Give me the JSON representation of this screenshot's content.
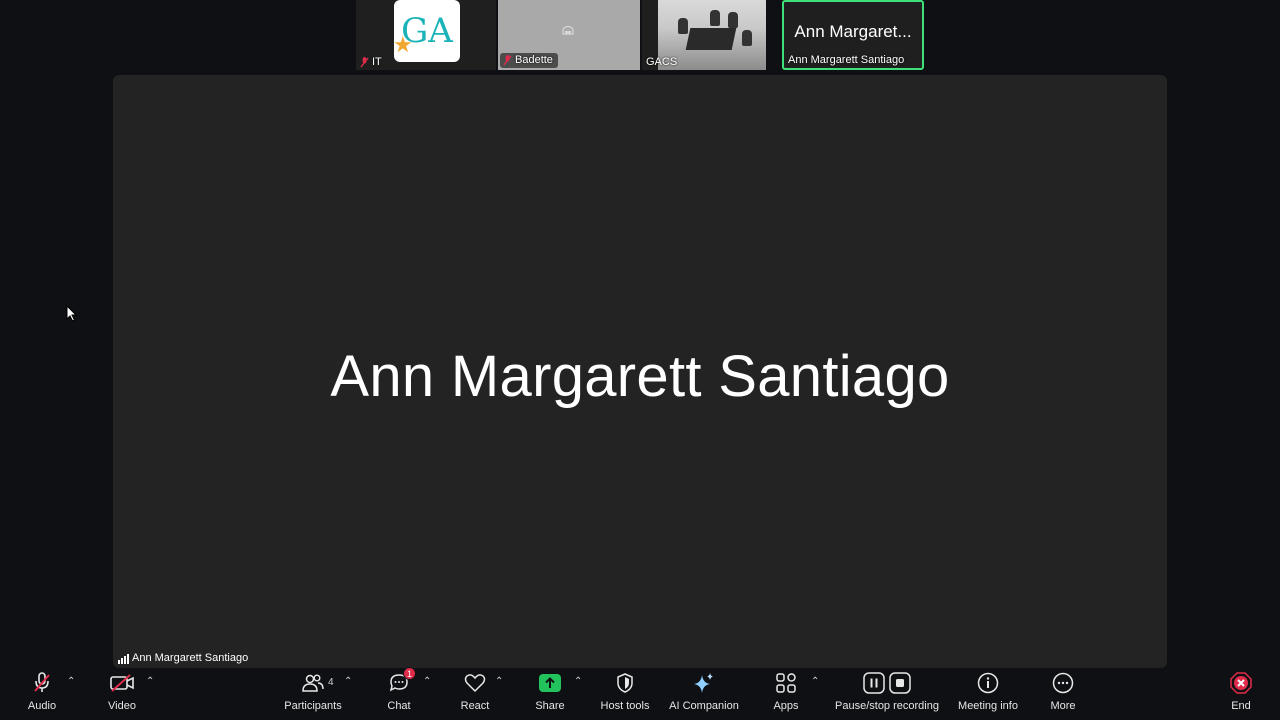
{
  "filmstrip": {
    "it": {
      "name": "IT",
      "logo_text": "GA"
    },
    "badette": {
      "name": "Badette"
    },
    "gacs": {
      "name": "GACS"
    },
    "ann": {
      "display": "Ann Margaret...",
      "name": "Ann Margarett Santiago"
    }
  },
  "stage": {
    "speaker_name": "Ann Margarett Santiago",
    "label": "Ann Margarett Santiago"
  },
  "toolbar": {
    "audio": "Audio",
    "video": "Video",
    "participants": "Participants",
    "participants_count": "4",
    "chat": "Chat",
    "chat_badge": "1",
    "react": "React",
    "share": "Share",
    "host_tools": "Host tools",
    "ai_companion": "AI Companion",
    "apps": "Apps",
    "recording": "Pause/stop recording",
    "meeting_info": "Meeting info",
    "more": "More",
    "end": "End"
  },
  "colors": {
    "active_speaker_border": "#3fe07a",
    "share_green": "#22c35c",
    "end_red": "#e02c4b",
    "muted_red": "#e02c4b"
  },
  "icons": [
    "mic-muted-icon",
    "video-off-icon",
    "participants-icon",
    "chat-icon",
    "react-heart-icon",
    "share-up-icon",
    "shield-icon",
    "sparkle-icon",
    "apps-icon",
    "pause-icon",
    "stop-icon",
    "info-icon",
    "more-icon",
    "end-icon",
    "caret-up-icon",
    "cursor-icon"
  ]
}
